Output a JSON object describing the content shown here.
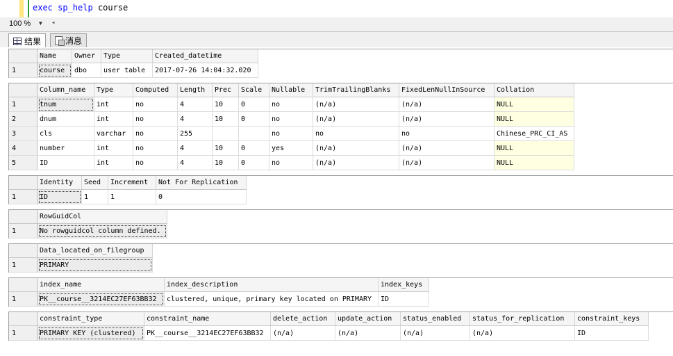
{
  "editor": {
    "keyword": "exec sp_help",
    "object": "course"
  },
  "zoom": {
    "value": "100 %"
  },
  "tabs": [
    {
      "label": "结果"
    },
    {
      "label": "消息"
    }
  ],
  "grids": [
    {
      "columns": [
        "Name",
        "Owner",
        "Type",
        "Created_datetime"
      ],
      "widths": [
        50,
        42,
        74,
        152
      ],
      "rows": [
        [
          "course",
          "dbo",
          "user table",
          "2017-07-26 14:04:32.020"
        ]
      ]
    },
    {
      "columns": [
        "Column_name",
        "Type",
        "Computed",
        "Length",
        "Prec",
        "Scale",
        "Nullable",
        "TrimTrailingBlanks",
        "FixedLenNullInSource",
        "Collation"
      ],
      "widths": [
        82,
        56,
        64,
        50,
        38,
        44,
        63,
        124,
        137,
        115
      ],
      "yellow_col": 9,
      "rows": [
        [
          "tnum",
          "int",
          "no",
          "4",
          "10",
          "0",
          "no",
          "(n/a)",
          "(n/a)",
          "NULL"
        ],
        [
          "dnum",
          "int",
          "no",
          "4",
          "10",
          "0",
          "no",
          "(n/a)",
          "(n/a)",
          "NULL"
        ],
        [
          "cls",
          "varchar",
          "no",
          "255",
          "",
          "",
          "no",
          "no",
          "no",
          "Chinese_PRC_CI_AS"
        ],
        [
          "number",
          "int",
          "no",
          "4",
          "10",
          "0",
          "yes",
          "(n/a)",
          "(n/a)",
          "NULL"
        ],
        [
          "ID",
          "int",
          "no",
          "4",
          "10",
          "0",
          "no",
          "(n/a)",
          "(n/a)",
          "NULL"
        ]
      ]
    },
    {
      "columns": [
        "Identity",
        "Seed",
        "Increment",
        "Not For Replication"
      ],
      "widths": [
        64,
        38,
        69,
        130
      ],
      "rows": [
        [
          "ID",
          "1",
          "1",
          "0"
        ]
      ]
    },
    {
      "columns": [
        "RowGuidCol"
      ],
      "widths": [
        187
      ],
      "rows": [
        [
          "No rowguidcol column defined."
        ]
      ]
    },
    {
      "columns": [
        "Data_located_on_filegroup"
      ],
      "widths": [
        166
      ],
      "rows": [
        [
          "PRIMARY"
        ]
      ]
    },
    {
      "columns": [
        "index_name",
        "index_description",
        "index_keys"
      ],
      "widths": [
        183,
        308,
        73
      ],
      "rows": [
        [
          "PK__course__3214EC27EF63BB32",
          "clustered, unique, primary key located on PRIMARY",
          "ID"
        ]
      ]
    },
    {
      "columns": [
        "constraint_type",
        "constraint_name",
        "delete_action",
        "update_action",
        "status_enabled",
        "status_for_replication",
        "constraint_keys"
      ],
      "widths": [
        154,
        182,
        93,
        94,
        100,
        151,
        106
      ],
      "rows": [
        [
          "PRIMARY KEY (clustered)",
          "PK__course__3214EC27EF63BB32",
          "(n/a)",
          "(n/a)",
          "(n/a)",
          "(n/a)",
          "ID"
        ]
      ]
    }
  ]
}
